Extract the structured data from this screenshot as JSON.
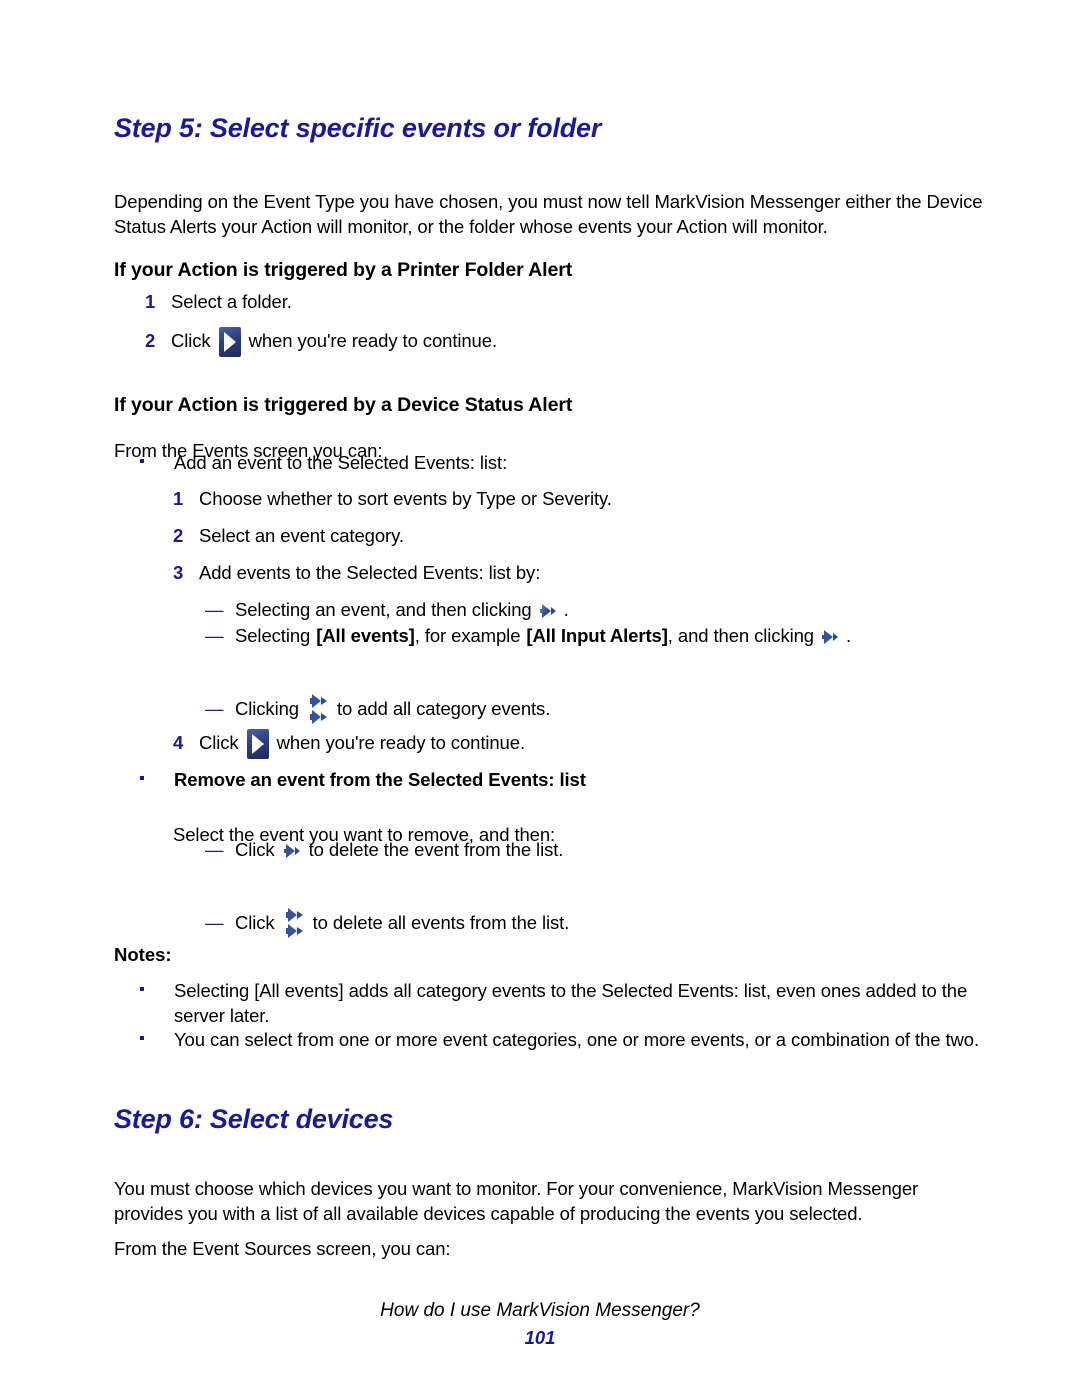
{
  "document": {
    "step5": {
      "heading": "Step 5: Select specific events or folder",
      "intro": "Depending on the Event Type you have chosen, you must now tell MarkVision Messenger either the Device Status Alerts your Action will monitor, or the folder whose events your Action will monitor.",
      "printer_folder": {
        "heading": "If your Action is triggered by a Printer Folder Alert",
        "items": [
          {
            "num": "1",
            "text": "Select a folder."
          },
          {
            "num": "2",
            "text_before": "Click",
            "icon": "next-button-icon",
            "text_after": "when you're ready to continue."
          }
        ]
      },
      "device_status": {
        "heading": "If your Action is triggered by a Device Status Alert",
        "intro": "From the Events screen you can:",
        "add_bullet": "Add an event to the Selected Events: list:",
        "add_steps": [
          {
            "num": "1",
            "text": "Choose whether to sort events by Type or Severity."
          },
          {
            "num": "2",
            "text": "Select an event category."
          },
          {
            "num": "3",
            "text": "Add events to the Selected Events: list by:"
          }
        ],
        "add_dashes": [
          {
            "text_before": "Selecting an event, and then clicking",
            "icon": "right-arrow-icon",
            "text_after": "."
          },
          {
            "text_before": "Selecting",
            "bold1": "[All events]",
            "mid1": ", for example",
            "bold2": "[All Input Alerts]",
            "mid2": ", and then clicking",
            "icon": "right-arrow-icon",
            "text_after": "."
          },
          {
            "text_before": "Clicking",
            "icon": "double-right-arrow-icon",
            "text_after": "to add all category events."
          }
        ],
        "step4": {
          "num": "4",
          "text_before": "Click",
          "icon": "next-button-icon",
          "text_after": "when you're ready to continue."
        },
        "remove_bullet": "Remove an event from the Selected Events: list",
        "remove_intro": "Select the event you want to remove, and then:",
        "remove_dashes": [
          {
            "text_before": "Click",
            "icon": "right-arrow-icon",
            "text_after": "to delete the event from the list."
          },
          {
            "text_before": "Click",
            "icon": "double-right-arrow-icon",
            "text_after": "to delete all events from the list."
          }
        ]
      },
      "notes": {
        "label": "Notes:",
        "items": [
          "Selecting [All events] adds all category events to the Selected Events: list, even ones added to the server later.",
          "You can select from one or more event categories, one or more events, or a combination of the two."
        ]
      }
    },
    "step6": {
      "heading": "Step 6: Select devices",
      "para1": "You must choose which devices you want to monitor. For your convenience, MarkVision Messenger provides you with a list of all available devices capable of producing the events you selected.",
      "para2": "From the Event Sources screen, you can:"
    },
    "footer": {
      "title": "How do I use MarkVision Messenger?",
      "page": "101"
    },
    "colors": {
      "heading_blue": "#1a1a99",
      "body_black": "#000000",
      "page_background": "#ffffff"
    }
  }
}
